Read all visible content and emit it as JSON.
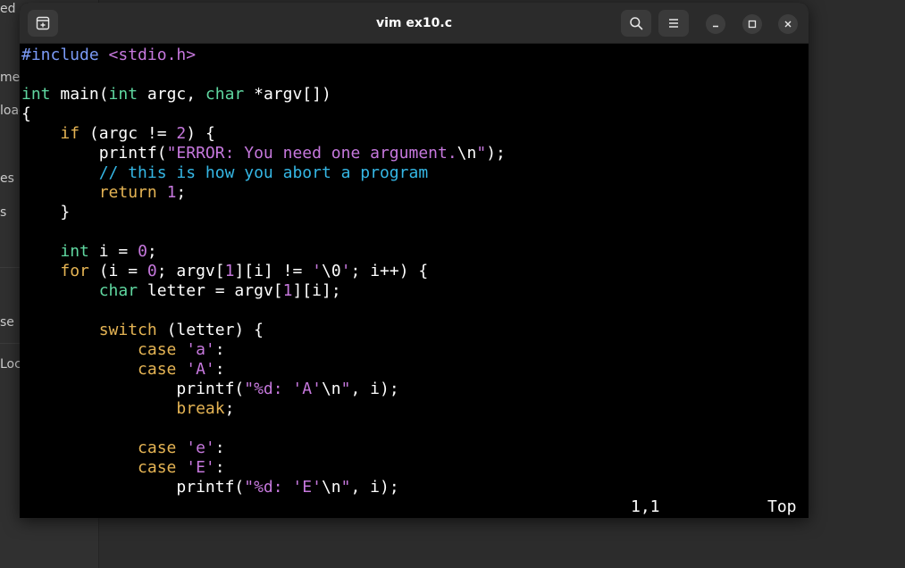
{
  "window": {
    "title": "vim ex10.c"
  },
  "background_sidebar": {
    "items": [
      "ed",
      "mer",
      "loac",
      "es",
      "s",
      "se",
      "Loc"
    ]
  },
  "editor": {
    "lines": [
      [
        {
          "t": "pre",
          "v": "#include "
        },
        {
          "t": "inc",
          "v": "<stdio.h>"
        }
      ],
      [],
      [
        {
          "t": "type",
          "v": "int"
        },
        {
          "t": "plain",
          "v": " main("
        },
        {
          "t": "type",
          "v": "int"
        },
        {
          "t": "plain",
          "v": " argc, "
        },
        {
          "t": "type",
          "v": "char"
        },
        {
          "t": "plain",
          "v": " *argv[])"
        }
      ],
      [
        {
          "t": "plain",
          "v": "{"
        }
      ],
      [
        {
          "t": "plain",
          "v": "    "
        },
        {
          "t": "kw",
          "v": "if"
        },
        {
          "t": "plain",
          "v": " (argc != "
        },
        {
          "t": "num",
          "v": "2"
        },
        {
          "t": "plain",
          "v": ") {"
        }
      ],
      [
        {
          "t": "plain",
          "v": "        printf("
        },
        {
          "t": "str",
          "v": "\"ERROR: You need one argument."
        },
        {
          "t": "plain",
          "v": "\\n"
        },
        {
          "t": "str",
          "v": "\""
        },
        {
          "t": "plain",
          "v": ");"
        }
      ],
      [
        {
          "t": "plain",
          "v": "        "
        },
        {
          "t": "cmt",
          "v": "// this is how you abort a program"
        }
      ],
      [
        {
          "t": "plain",
          "v": "        "
        },
        {
          "t": "kw",
          "v": "return"
        },
        {
          "t": "plain",
          "v": " "
        },
        {
          "t": "num",
          "v": "1"
        },
        {
          "t": "plain",
          "v": ";"
        }
      ],
      [
        {
          "t": "plain",
          "v": "    }"
        }
      ],
      [],
      [
        {
          "t": "plain",
          "v": "    "
        },
        {
          "t": "type",
          "v": "int"
        },
        {
          "t": "plain",
          "v": " i = "
        },
        {
          "t": "num",
          "v": "0"
        },
        {
          "t": "plain",
          "v": ";"
        }
      ],
      [
        {
          "t": "plain",
          "v": "    "
        },
        {
          "t": "kw",
          "v": "for"
        },
        {
          "t": "plain",
          "v": " (i = "
        },
        {
          "t": "num",
          "v": "0"
        },
        {
          "t": "plain",
          "v": "; argv["
        },
        {
          "t": "num",
          "v": "1"
        },
        {
          "t": "plain",
          "v": "][i] != "
        },
        {
          "t": "str",
          "v": "'"
        },
        {
          "t": "plain",
          "v": "\\0"
        },
        {
          "t": "str",
          "v": "'"
        },
        {
          "t": "plain",
          "v": "; i++) {"
        }
      ],
      [
        {
          "t": "plain",
          "v": "        "
        },
        {
          "t": "type",
          "v": "char"
        },
        {
          "t": "plain",
          "v": " letter = argv["
        },
        {
          "t": "num",
          "v": "1"
        },
        {
          "t": "plain",
          "v": "][i];"
        }
      ],
      [],
      [
        {
          "t": "plain",
          "v": "        "
        },
        {
          "t": "kw",
          "v": "switch"
        },
        {
          "t": "plain",
          "v": " (letter) {"
        }
      ],
      [
        {
          "t": "plain",
          "v": "            "
        },
        {
          "t": "kw",
          "v": "case"
        },
        {
          "t": "plain",
          "v": " "
        },
        {
          "t": "str",
          "v": "'a'"
        },
        {
          "t": "plain",
          "v": ":"
        }
      ],
      [
        {
          "t": "plain",
          "v": "            "
        },
        {
          "t": "kw",
          "v": "case"
        },
        {
          "t": "plain",
          "v": " "
        },
        {
          "t": "str",
          "v": "'A'"
        },
        {
          "t": "plain",
          "v": ":"
        }
      ],
      [
        {
          "t": "plain",
          "v": "                printf("
        },
        {
          "t": "str",
          "v": "\"%d: 'A'"
        },
        {
          "t": "plain",
          "v": "\\n"
        },
        {
          "t": "str",
          "v": "\""
        },
        {
          "t": "plain",
          "v": ", i);"
        }
      ],
      [
        {
          "t": "plain",
          "v": "                "
        },
        {
          "t": "kw",
          "v": "break"
        },
        {
          "t": "plain",
          "v": ";"
        }
      ],
      [],
      [
        {
          "t": "plain",
          "v": "            "
        },
        {
          "t": "kw",
          "v": "case"
        },
        {
          "t": "plain",
          "v": " "
        },
        {
          "t": "str",
          "v": "'e'"
        },
        {
          "t": "plain",
          "v": ":"
        }
      ],
      [
        {
          "t": "plain",
          "v": "            "
        },
        {
          "t": "kw",
          "v": "case"
        },
        {
          "t": "plain",
          "v": " "
        },
        {
          "t": "str",
          "v": "'E'"
        },
        {
          "t": "plain",
          "v": ":"
        }
      ],
      [
        {
          "t": "plain",
          "v": "                printf("
        },
        {
          "t": "str",
          "v": "\"%d: 'E'"
        },
        {
          "t": "plain",
          "v": "\\n"
        },
        {
          "t": "str",
          "v": "\""
        },
        {
          "t": "plain",
          "v": ", i);"
        }
      ]
    ]
  },
  "status": {
    "position": "1,1",
    "scroll": "Top"
  },
  "colors": {
    "preproc": "#7b9bf7",
    "include": "#c678dd",
    "type": "#5fd7a0",
    "keyword": "#e5b454",
    "string": "#c678dd",
    "number": "#c678dd",
    "comment": "#35b7e5",
    "text": "#ffffff",
    "background": "#000000"
  },
  "icons": {
    "new_tab": "new-tab-icon",
    "search": "search-icon",
    "menu": "hamburger-menu-icon",
    "minimize": "minimize-icon",
    "maximize": "maximize-icon",
    "close": "close-icon"
  }
}
